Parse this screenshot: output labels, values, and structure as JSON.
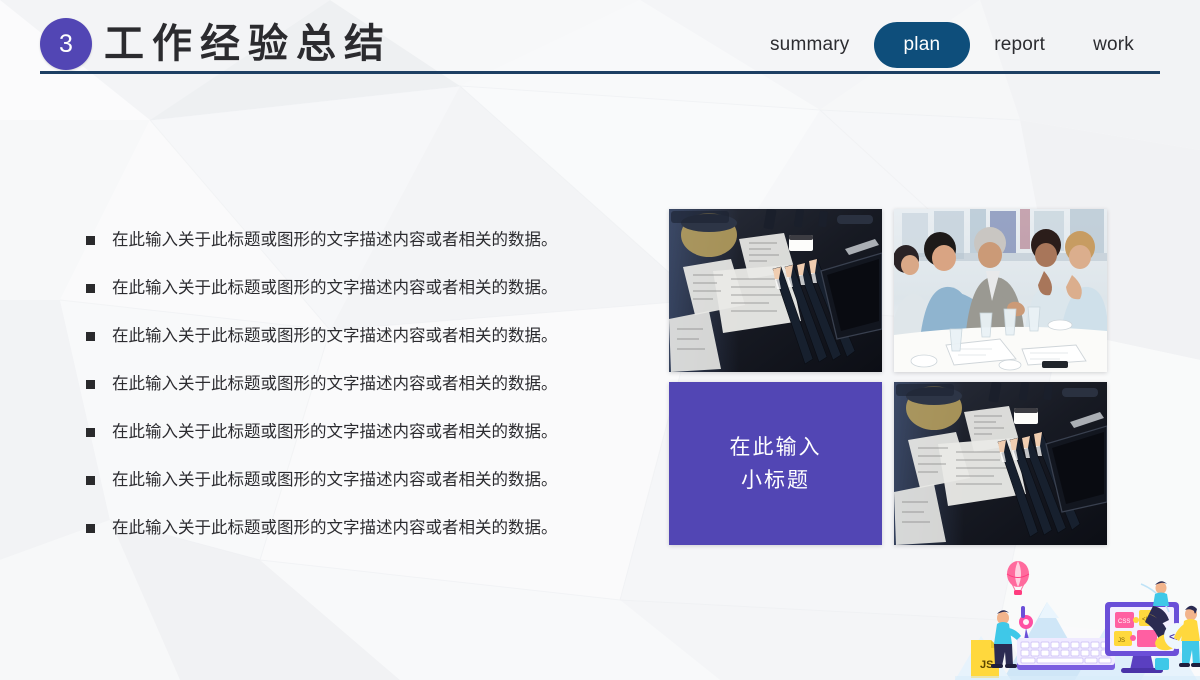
{
  "header": {
    "section_number": "3",
    "title": "工作经验总结",
    "badge_color": "#5246b4",
    "rule_color": "#1d3f63",
    "title_color": "#2b2b2f"
  },
  "nav": {
    "active_color": "#0e4e7b",
    "items": [
      {
        "label": "summary",
        "active": false
      },
      {
        "label": "plan",
        "active": true
      },
      {
        "label": "report",
        "active": false
      },
      {
        "label": "work",
        "active": false
      }
    ]
  },
  "bullets": {
    "marker": "square-bullet",
    "items": [
      {
        "text": "在此输入关于此标题或图形的文字描述内容或者相关的数据。"
      },
      {
        "text": "在此输入关于此标题或图形的文字描述内容或者相关的数据。"
      },
      {
        "text": "在此输入关于此标题或图形的文字描述内容或者相关的数据。"
      },
      {
        "text": "在此输入关于此标题或图形的文字描述内容或者相关的数据。"
      },
      {
        "text": "在此输入关于此标题或图形的文字描述内容或者相关的数据。"
      },
      {
        "text": "在此输入关于此标题或图形的文字描述内容或者相关的数据。"
      },
      {
        "text": "在此输入关于此标题或图形的文字描述内容或者相关的数据。"
      }
    ]
  },
  "media_grid": {
    "cells": [
      {
        "kind": "photo",
        "subject": "desk-with-sketch-notes-and-pencils"
      },
      {
        "kind": "photo",
        "subject": "business-team-meeting"
      },
      {
        "kind": "caption",
        "color": "#5246b4",
        "line1": "在此输入",
        "line2": "小标题"
      },
      {
        "kind": "photo",
        "subject": "desk-with-sketch-notes-and-pencils"
      }
    ]
  },
  "illustration": {
    "name": "web-development-flat-illustration",
    "labels": {
      "js_badge": "JS",
      "puzzle_css": "CSS",
      "puzzle_js": "JS",
      "puzzle_code": "</>",
      "code_tag": "</>"
    }
  },
  "background": {
    "style": "low-poly-light-gray",
    "base_color": "#fbfbfc"
  }
}
